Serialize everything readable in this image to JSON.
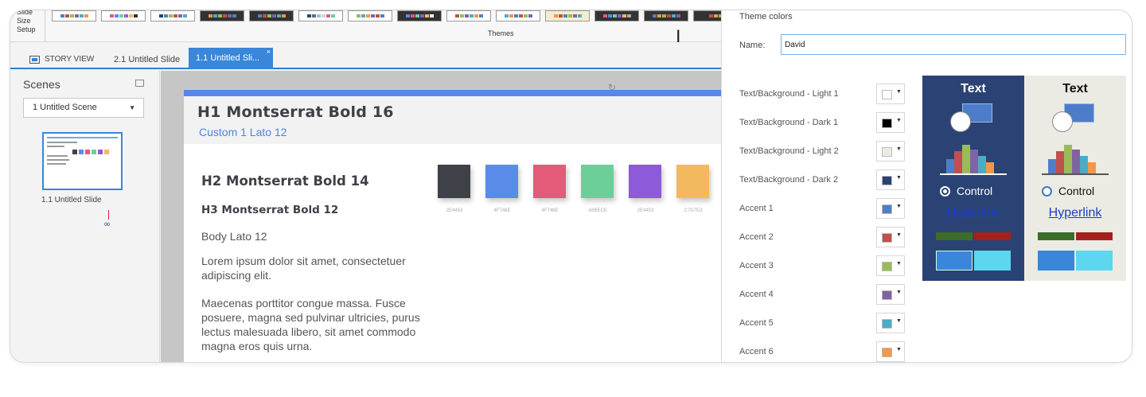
{
  "ribbon": {
    "slide_size_lines": [
      "Slide",
      "Size",
      "Setup"
    ],
    "themes_label": "Themes"
  },
  "tabs": {
    "story_view": "STORY VIEW",
    "slide_2_1": "2.1 Untitled Slide",
    "slide_1_1": "1.1 Untitled Sli...",
    "close_glyph": "×"
  },
  "scenes": {
    "title": "Scenes",
    "selected_scene": "1 Untitled Scene",
    "thumbnail_label": "1.1 Untitled Slide"
  },
  "slide": {
    "h1": "H1 Montserrat Bold 16",
    "custom1": "Custom 1 Lato 12",
    "h2": "H2 Montserrat Bold 14",
    "h3": "H3 Montserrat Bold 12",
    "body": "Body Lato 12",
    "para1": "Lorem ipsum dolor sit amet, consectetuer adipiscing elit.",
    "para2": "Maecenas porttitor congue massa. Fusce posuere, magna sed pulvinar ultricies, purus lectus malesuada libero, sit amet commodo magna eros quis urna.",
    "swatches": [
      {
        "color": "#3f4149",
        "code": "2E4453"
      },
      {
        "color": "#5b8be9",
        "code": "4F748E"
      },
      {
        "color": "#e35b79",
        "code": "4F748E"
      },
      {
        "color": "#6ccf9a",
        "code": "A8BECE"
      },
      {
        "color": "#8d5ad9",
        "code": "2E4453"
      },
      {
        "color": "#f3b95e",
        "code": "C7D7E3"
      }
    ]
  },
  "theme_panel": {
    "title": "Theme colors",
    "name_label": "Name:",
    "name_value": "David",
    "rows": [
      {
        "label": "Text/Background - Light 1",
        "color": "#ffffff"
      },
      {
        "label": "Text/Background - Dark 1",
        "color": "#000000"
      },
      {
        "label": "Text/Background - Light 2",
        "color": "#ecebe3"
      },
      {
        "label": "Text/Background - Dark 2",
        "color": "#2a4374"
      },
      {
        "label": "Accent 1",
        "color": "#4f7ec9"
      },
      {
        "label": "Accent 2",
        "color": "#c0504d"
      },
      {
        "label": "Accent 3",
        "color": "#9bbb59"
      },
      {
        "label": "Accent 4",
        "color": "#8064a2"
      },
      {
        "label": "Accent 5",
        "color": "#4bacc6"
      },
      {
        "label": "Accent 6",
        "color": "#f79646"
      }
    ],
    "preview_dark": {
      "title": "Text",
      "control": "Control",
      "link": "Hyperlink"
    },
    "preview_light": {
      "title": "Text",
      "control": "Control",
      "link": "Hyperlink"
    }
  }
}
